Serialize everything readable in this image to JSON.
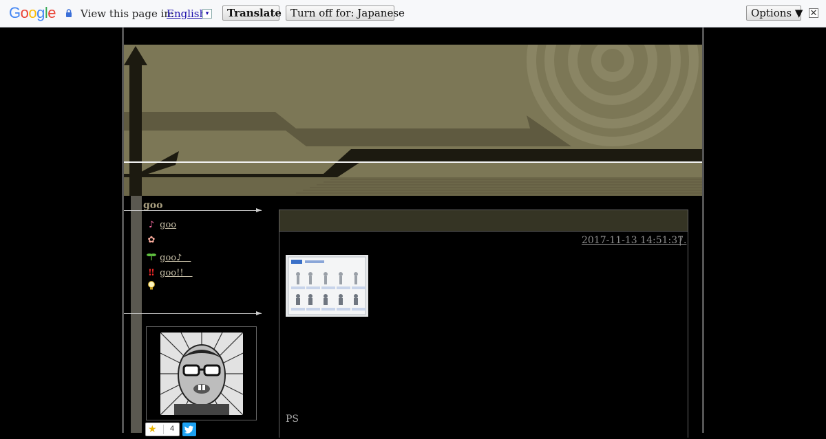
{
  "translate_bar": {
    "logo_letters": [
      {
        "ch": "G",
        "color": "#4285F4"
      },
      {
        "ch": "o",
        "color": "#EA4335"
      },
      {
        "ch": "o",
        "color": "#FBBC05"
      },
      {
        "ch": "g",
        "color": "#4285F4"
      },
      {
        "ch": "l",
        "color": "#34A853"
      },
      {
        "ch": "e",
        "color": "#EA4335"
      }
    ],
    "view_label": "View this page in:",
    "language": "English",
    "dropdown_glyph": "▾",
    "translate_button": "Translate",
    "turn_off_button": "Turn off for: Japanese",
    "options_button": "Options ▼",
    "close_glyph": "✕"
  },
  "sidebar": {
    "title": "goo",
    "items": [
      {
        "icon": "♪",
        "icon_name": "music-note-icon",
        "icon_color": "#ff6fa8",
        "label": "goo"
      },
      {
        "icon": "✿",
        "icon_name": "flower-icon",
        "icon_color": "#ffb0a0",
        "label": ""
      },
      {
        "icon": "🌱",
        "icon_name": "sprout-icon",
        "icon_color": "#5fbf3f",
        "label": "goo♪　"
      },
      {
        "icon": "‼",
        "icon_name": "double-exclamation-icon",
        "icon_color": "#ff2a2a",
        "label": "goo!!　"
      },
      {
        "icon": "💡",
        "icon_name": "lightbulb-icon",
        "icon_color": "#f0d040",
        "label": ""
      }
    ],
    "star_count": "4"
  },
  "post": {
    "date": "2017-11-13 14:51:37",
    "separator": "|",
    "more_link": ".",
    "ps": "PS"
  },
  "colors": {
    "header_olive": "#7c7756",
    "header_dark": "#1c1a10",
    "post_header_bg": "#353424"
  }
}
